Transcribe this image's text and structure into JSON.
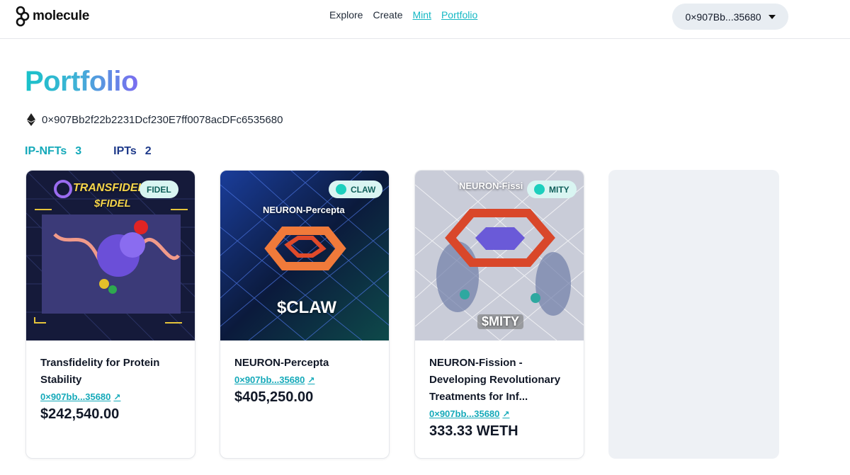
{
  "header": {
    "brand": "molecule",
    "nav": [
      {
        "label": "Explore",
        "active": false
      },
      {
        "label": "Create",
        "active": false
      },
      {
        "label": "Mint",
        "active": true
      },
      {
        "label": "Portfolio",
        "active": true
      }
    ],
    "wallet": "0×907Bb...35680"
  },
  "page": {
    "title": "Portfolio",
    "address": "0×907Bb2f22b2231Dcf230E7ff0078acDFc6535680",
    "counts": {
      "ip_nfts_label": "IP-NFTs",
      "ip_nfts": "3",
      "ipts_label": "IPTs",
      "ipts": "2"
    }
  },
  "cards": [
    {
      "badge": "FIDEL",
      "image_title": "TRANSFIDELITY",
      "image_ticker": "$FIDEL",
      "title": "Transfidelity for Protein Stability",
      "link": "0×907bb...35680",
      "price": "$242,540.00"
    },
    {
      "badge": "CLAW",
      "image_title": "NEURON-Percepta",
      "image_ticker": "$CLAW",
      "title": "NEURON-Percepta",
      "link": "0×907bb...35680",
      "price": "$405,250.00"
    },
    {
      "badge": "MITY",
      "image_title": "NEURON-Fissi",
      "image_ticker": "$MITY",
      "title": "NEURON-Fission - Developing Revolutionary Treatments for Inf...",
      "link": "0×907bb...35680",
      "price": "333.33 WETH"
    }
  ],
  "colors": {
    "accent": "#14a9b9",
    "title_gradient_start": "#19c2c9",
    "title_gradient_end": "#7b6cf0"
  }
}
